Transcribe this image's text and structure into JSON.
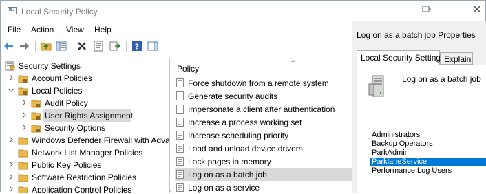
{
  "window": {
    "title": "Local Security Policy"
  },
  "menu": [
    "File",
    "Action",
    "View",
    "Help"
  ],
  "tree": {
    "items": [
      {
        "label": "Security Settings",
        "level": 0,
        "expanded": true,
        "icon": "security-settings-icon"
      },
      {
        "label": "Account Policies",
        "level": 1,
        "expanded": false,
        "icon": "folder-icon"
      },
      {
        "label": "Local Policies",
        "level": 1,
        "expanded": true,
        "icon": "folder-icon"
      },
      {
        "label": "Audit Policy",
        "level": 2,
        "expanded": false,
        "icon": "folder-icon"
      },
      {
        "label": "User Rights Assignment",
        "level": 2,
        "expanded": false,
        "icon": "folder-icon",
        "selected": true
      },
      {
        "label": "Security Options",
        "level": 2,
        "expanded": false,
        "icon": "folder-icon"
      },
      {
        "label": "Windows Defender Firewall with Adva",
        "level": 1,
        "expanded": false,
        "icon": "folder-icon"
      },
      {
        "label": "Network List Manager Policies",
        "level": 1,
        "expanded": false,
        "icon": "folder-icon"
      },
      {
        "label": "Public Key Policies",
        "level": 1,
        "expanded": false,
        "icon": "folder-icon"
      },
      {
        "label": "Software Restriction Policies",
        "level": 1,
        "expanded": false,
        "icon": "folder-icon"
      },
      {
        "label": "Application Control Policies",
        "level": 1,
        "expanded": false,
        "icon": "folder-icon"
      }
    ]
  },
  "list": {
    "column_header": "Policy",
    "rows": [
      {
        "label": "Force shutdown from a remote system"
      },
      {
        "label": "Generate security audits"
      },
      {
        "label": "Impersonate a client after authentication"
      },
      {
        "label": "Increase a process working set"
      },
      {
        "label": "Increase scheduling priority"
      },
      {
        "label": "Load and unload device drivers"
      },
      {
        "label": "Lock pages in memory"
      },
      {
        "label": "Log on as a batch job",
        "selected": true
      },
      {
        "label": "Log on as a service"
      }
    ]
  },
  "dialog": {
    "title": "Log on as a batch job Properties",
    "tabs": [
      {
        "label": "Local Security Setting",
        "active": true
      },
      {
        "label": "Explain",
        "active": false
      }
    ],
    "panel_title": "Log on as a batch job",
    "accounts": [
      {
        "label": "Administrators"
      },
      {
        "label": "Backup Operators"
      },
      {
        "label": "ParkAdmin"
      },
      {
        "label": "ParklaneService",
        "selected": true
      },
      {
        "label": "Performance Log Users"
      }
    ]
  },
  "colors": {
    "selection": "#0078d7",
    "tree_selection": "#d9d9d9",
    "folder": "#e8b84a"
  }
}
